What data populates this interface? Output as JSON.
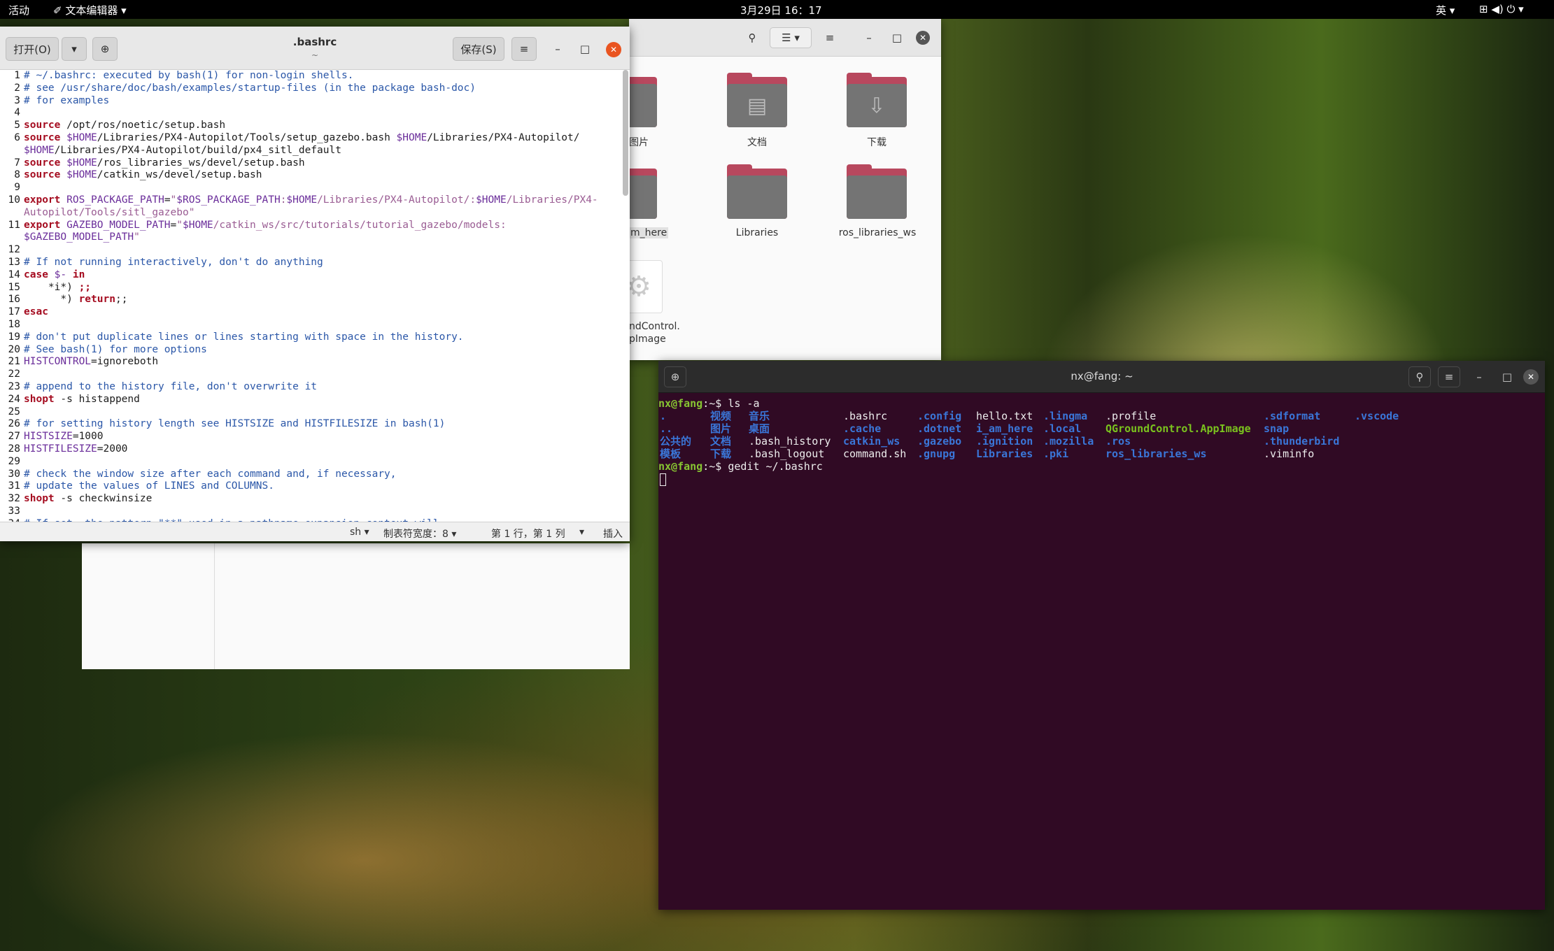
{
  "topbar": {
    "activities": "活动",
    "app_menu": "✐ 文本编辑器 ▾",
    "clock": "3月29日 16：17",
    "lang": "英 ▾",
    "status_icons": "⊞ ◀) ⏻ ▾"
  },
  "files": {
    "items": [
      {
        "label": "图片",
        "icon": "image-icon"
      },
      {
        "label": "文档",
        "icon": "document-icon"
      },
      {
        "label": "下载",
        "icon": "download-icon"
      },
      {
        "label": "m_here",
        "icon": "folder-icon"
      },
      {
        "label": "Libraries",
        "icon": "folder-icon"
      },
      {
        "label": "ros_libraries_ws",
        "icon": "folder-icon"
      },
      {
        "label": "ndControl.",
        "label2": "pImage",
        "icon": "appimage-icon"
      }
    ]
  },
  "gedit": {
    "open_label": "打开(O)",
    "title": ".bashrc",
    "subtitle": "~",
    "save_label": "保存(S)",
    "lines": [
      "1",
      "2",
      "3",
      "4",
      "5",
      "6",
      "",
      "7",
      "8",
      "9",
      "10",
      "",
      "11",
      "",
      "12",
      "13",
      "14",
      "15",
      "16",
      "17",
      "18",
      "19",
      "20",
      "21",
      "22",
      "23",
      "24",
      "25",
      "26",
      "27",
      "28",
      "29",
      "30",
      "31",
      "32",
      "33",
      "34"
    ],
    "status": {
      "lang": "sh ▾",
      "tab": "制表符宽度：8 ▾",
      "pos": "第 1 行，第 1 列",
      "pos_arrow": "▾",
      "mode": "插入"
    }
  },
  "terminal": {
    "title": "nx@fang: ~",
    "prompt_user": "nx@fang",
    "prompt_sep": ":~$ ",
    "cmd1": "ls -a",
    "cmd2": "gedit ~/.bashrc",
    "ls_rows": [
      [
        ".",
        "视频",
        "音乐",
        ".bashrc",
        ".config",
        "hello.txt",
        ".lingma",
        ".profile",
        ".sdformat",
        ".vscode"
      ],
      [
        "..",
        "图片",
        "桌面",
        ".cache",
        ".dotnet",
        "i_am_here",
        ".local",
        "QGroundControl.AppImage",
        "snap",
        ""
      ],
      [
        "公共的",
        "文档",
        ".bash_history",
        "catkin_ws",
        ".gazebo",
        ".ignition",
        ".mozilla",
        ".ros",
        ".thunderbird",
        ""
      ],
      [
        "模板",
        "下载",
        ".bash_logout",
        "command.sh",
        ".gnupg",
        "Libraries",
        ".pki",
        "ros_libraries_ws",
        ".viminfo",
        ""
      ]
    ]
  }
}
